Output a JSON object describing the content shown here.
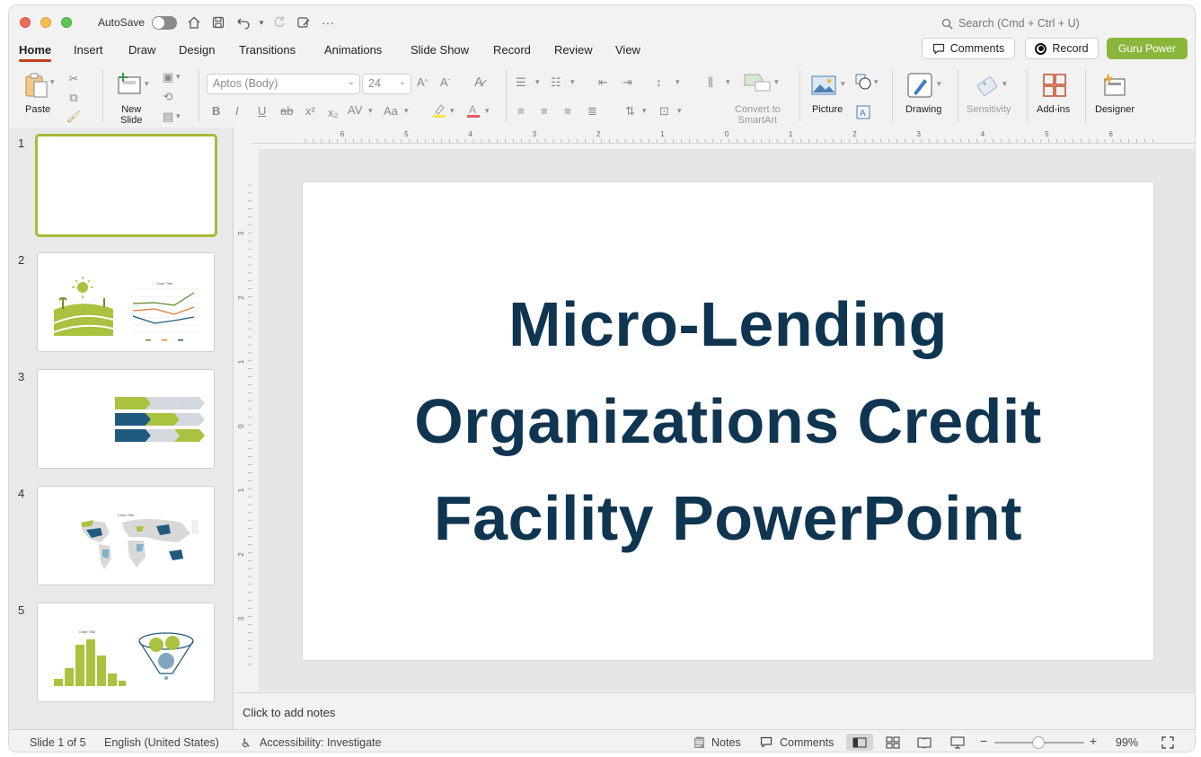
{
  "titlebar": {
    "autosave_label": "AutoSave",
    "search_placeholder": "Search (Cmd + Ctrl + U)"
  },
  "tabs": [
    "Home",
    "Insert",
    "Draw",
    "Design",
    "Transitions",
    "Animations",
    "Slide Show",
    "Record",
    "Review",
    "View"
  ],
  "top_buttons": {
    "comments": "Comments",
    "record": "Record",
    "guru": "Guru Power"
  },
  "ribbon": {
    "paste": "Paste",
    "new_slide_line1": "New",
    "new_slide_line2": "Slide",
    "font_name": "Aptos (Body)",
    "font_size": "24",
    "convert_line1": "Convert to",
    "convert_line2": "SmartArt",
    "picture": "Picture",
    "drawing": "Drawing",
    "sensitivity": "Sensitivity",
    "addins": "Add-ins",
    "designer": "Designer"
  },
  "slides": [
    "1",
    "2",
    "3",
    "4",
    "5"
  ],
  "thumb_labels": {
    "chart_title": "Chart Title"
  },
  "slide": {
    "title_line1": "Micro-Lending",
    "title_line2": "Organizations Credit",
    "title_line3": "Facility PowerPoint"
  },
  "notes_placeholder": "Click to add notes",
  "status": {
    "slide_of": "Slide 1 of 5",
    "language": "English (United States)",
    "accessibility": "Accessibility: Investigate",
    "notes": "Notes",
    "comments": "Comments",
    "zoom": "99%"
  },
  "ruler": {
    "h_ticks": [
      "6",
      "5",
      "4",
      "3",
      "2",
      "1",
      "0",
      "1",
      "2",
      "3",
      "4",
      "5",
      "6"
    ],
    "v_ticks": [
      "3",
      "2",
      "1",
      "0",
      "1",
      "2",
      "3"
    ]
  },
  "colors": {
    "accent_red": "#c43e1c",
    "guru_green": "#8bb63c",
    "title_navy": "#0f3550",
    "thumb_green": "#a9c23f",
    "thumb_blue": "#1f5b7f",
    "thumb_gray": "#d3d8de"
  }
}
